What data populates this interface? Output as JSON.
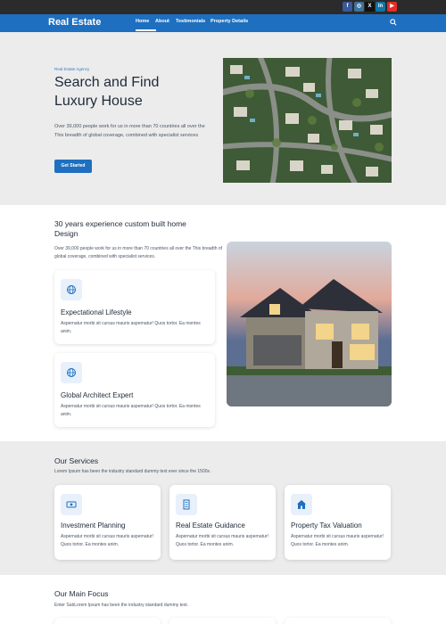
{
  "social": [
    {
      "icon": "facebook-icon",
      "glyph": "f",
      "color": "#3b5998"
    },
    {
      "icon": "instagram-icon",
      "glyph": "◎",
      "color": "#3f729b"
    },
    {
      "icon": "x-twitter-icon",
      "glyph": "X",
      "color": "#111111"
    },
    {
      "icon": "linkedin-icon",
      "glyph": "in",
      "color": "#0e76a8"
    },
    {
      "icon": "youtube-icon",
      "glyph": "▶",
      "color": "#e52d27"
    }
  ],
  "nav": {
    "brand": "Real Estate",
    "links": [
      "Home",
      "About",
      "Testimonials",
      "Property Details"
    ],
    "active": "Home"
  },
  "hero": {
    "kicker": "Real Estate Agency",
    "title": "Search and Find Luxury House",
    "description": "Over 39,000 people work for us in more than 70 countries all over the This breadth of global coverage, combined with specialist services",
    "button": "Get Started"
  },
  "experience": {
    "title": "30 years experience custom built home Design",
    "description": "Over 39,000 people work for us in more than 70 countries all over the This breadth of global coverage, combined with specialist services.",
    "cards": [
      {
        "icon": "globe-icon",
        "title": "Expectational Lifestyle",
        "text": "Aspernatur morbi sit cursus mauris aspernatur! Quos tortor. Ea montes anim."
      },
      {
        "icon": "globe-icon",
        "title": "Global Architect Expert",
        "text": "Aspernatur morbi sit cursus mauris aspernatur! Quos tortor. Ea montes anim."
      }
    ]
  },
  "services": {
    "title": "Our Services",
    "description": "Lorem Ipsum has been the industry standard dummy text ever since the 1500s .",
    "cards": [
      {
        "icon": "money-icon",
        "title": "Investment Planning",
        "text": "Aspernatur morbi sit cursus mauris aspernatur! Quos tortor. Ea montes anim."
      },
      {
        "icon": "building-icon",
        "title": "Real Estate Guidance",
        "text": "Aspernatur morbi sit cursus mauris aspernatur! Quos tortor. Ea montes anim."
      },
      {
        "icon": "home-icon",
        "title": "Property Tax Valuation",
        "text": "Aspernatur morbi sit cursus mauris aspernatur! Quos tortor. Ea montes anim."
      }
    ]
  },
  "focus": {
    "title": "Our Main Focus",
    "description": "Enter SubLorem Ipsum has been the industry standard dummy text."
  },
  "colors": {
    "primary": "#1e6fbf",
    "accent_light": "#e7f0fb",
    "heading": "#1e2a3a"
  }
}
